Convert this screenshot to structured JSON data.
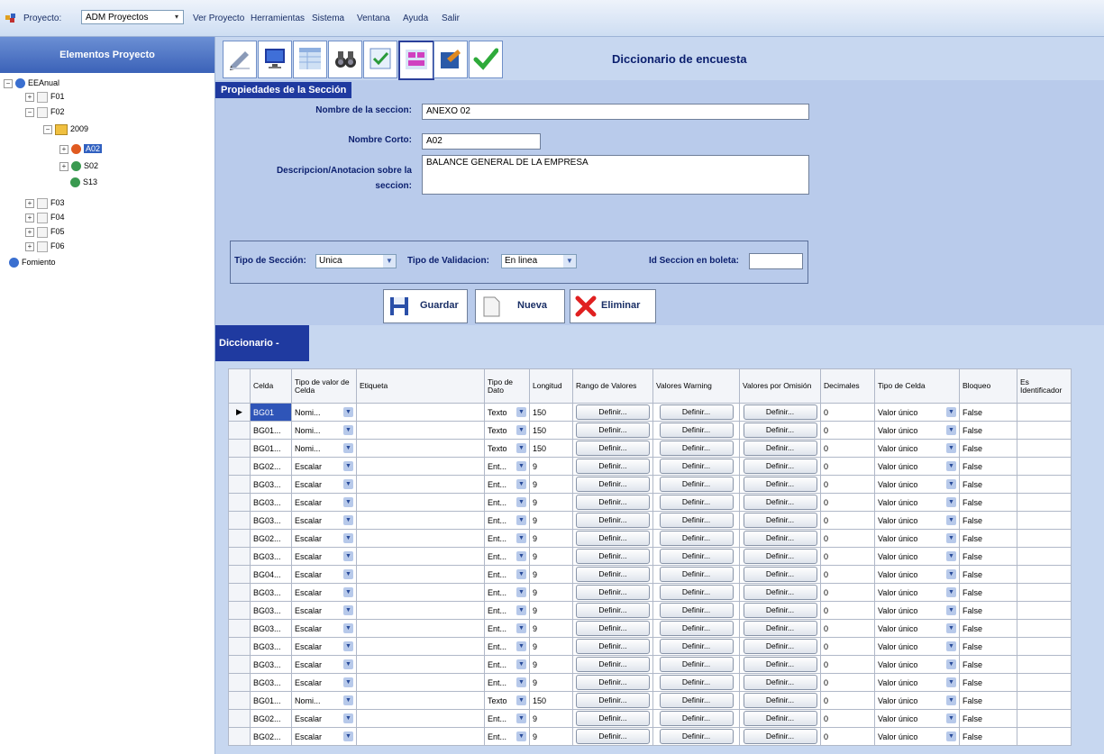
{
  "menubar": {
    "project_label": "Proyecto:",
    "project_value": "ADM Proyectos",
    "items": [
      "Ver Proyecto",
      "Herramientas",
      "Sistema",
      "Ventana",
      "Ayuda",
      "Salir"
    ]
  },
  "sidebar": {
    "title": "Elementos Proyecto",
    "tree": {
      "root": "EEAnual",
      "f01": "F01",
      "f02": "F02",
      "year": "2009",
      "a02": "A02",
      "s02": "S02",
      "s13": "S13",
      "f03": "F03",
      "f04": "F04",
      "f05": "F05",
      "f06": "F06",
      "fomiento": "Fomiento"
    }
  },
  "toolbar": {
    "title": "Diccionario de encuesta",
    "icons": [
      "pen-icon",
      "monitor-icon",
      "grid-icon",
      "binoculars-icon",
      "checklist-icon",
      "layout-icon",
      "export-icon",
      "checkmark-icon"
    ]
  },
  "section": {
    "title": "Propiedades de la Sección",
    "name_label": "Nombre de la seccion:",
    "name_value": "ANEXO 02",
    "short_label": "Nombre Corto:",
    "short_value": "A02",
    "desc_label_1": "Descripcion/Anotacion sobre la",
    "desc_label_2": "seccion:",
    "desc_value": "BALANCE GENERAL DE LA EMPRESA",
    "type_label": "Tipo de Sección:",
    "type_value": "Unica",
    "validation_label": "Tipo de Validacion:",
    "validation_value": "En linea",
    "ballot_label": "Id Seccion en boleta:",
    "ballot_value": ""
  },
  "actions": {
    "save": "Guardar",
    "new": "Nueva",
    "delete": "Eliminar"
  },
  "dictionary": {
    "tab_label": "Diccionario -",
    "columns": [
      "Celda",
      "Tipo de valor de Celda",
      "Etiqueta",
      "Tipo de Dato",
      "Longitud",
      "Rango de Valores",
      "Valores Warning",
      "Valores por Omisión",
      "Decimales",
      "Tipo de Celda",
      "Bloqueo",
      "Es Identificador"
    ],
    "button_label": "Definir...",
    "rows": [
      {
        "celda": "BG01",
        "tipo_valor": "Nomi...",
        "tipo_dato": "Texto",
        "longitud": "150",
        "decimales": "0",
        "tipo_celda": "Valor único",
        "bloqueo": "False"
      },
      {
        "celda": "BG01...",
        "tipo_valor": "Nomi...",
        "tipo_dato": "Texto",
        "longitud": "150",
        "decimales": "0",
        "tipo_celda": "Valor único",
        "bloqueo": "False"
      },
      {
        "celda": "BG01...",
        "tipo_valor": "Nomi...",
        "tipo_dato": "Texto",
        "longitud": "150",
        "decimales": "0",
        "tipo_celda": "Valor único",
        "bloqueo": "False"
      },
      {
        "celda": "BG02...",
        "tipo_valor": "Escalar",
        "tipo_dato": "Ent...",
        "longitud": "9",
        "decimales": "0",
        "tipo_celda": "Valor único",
        "bloqueo": "False"
      },
      {
        "celda": "BG03...",
        "tipo_valor": "Escalar",
        "tipo_dato": "Ent...",
        "longitud": "9",
        "decimales": "0",
        "tipo_celda": "Valor único",
        "bloqueo": "False"
      },
      {
        "celda": "BG03...",
        "tipo_valor": "Escalar",
        "tipo_dato": "Ent...",
        "longitud": "9",
        "decimales": "0",
        "tipo_celda": "Valor único",
        "bloqueo": "False"
      },
      {
        "celda": "BG03...",
        "tipo_valor": "Escalar",
        "tipo_dato": "Ent...",
        "longitud": "9",
        "decimales": "0",
        "tipo_celda": "Valor único",
        "bloqueo": "False"
      },
      {
        "celda": "BG02...",
        "tipo_valor": "Escalar",
        "tipo_dato": "Ent...",
        "longitud": "9",
        "decimales": "0",
        "tipo_celda": "Valor único",
        "bloqueo": "False"
      },
      {
        "celda": "BG03...",
        "tipo_valor": "Escalar",
        "tipo_dato": "Ent...",
        "longitud": "9",
        "decimales": "0",
        "tipo_celda": "Valor único",
        "bloqueo": "False"
      },
      {
        "celda": "BG04...",
        "tipo_valor": "Escalar",
        "tipo_dato": "Ent...",
        "longitud": "9",
        "decimales": "0",
        "tipo_celda": "Valor único",
        "bloqueo": "False"
      },
      {
        "celda": "BG03...",
        "tipo_valor": "Escalar",
        "tipo_dato": "Ent...",
        "longitud": "9",
        "decimales": "0",
        "tipo_celda": "Valor único",
        "bloqueo": "False"
      },
      {
        "celda": "BG03...",
        "tipo_valor": "Escalar",
        "tipo_dato": "Ent...",
        "longitud": "9",
        "decimales": "0",
        "tipo_celda": "Valor único",
        "bloqueo": "False"
      },
      {
        "celda": "BG03...",
        "tipo_valor": "Escalar",
        "tipo_dato": "Ent...",
        "longitud": "9",
        "decimales": "0",
        "tipo_celda": "Valor único",
        "bloqueo": "False"
      },
      {
        "celda": "BG03...",
        "tipo_valor": "Escalar",
        "tipo_dato": "Ent...",
        "longitud": "9",
        "decimales": "0",
        "tipo_celda": "Valor único",
        "bloqueo": "False"
      },
      {
        "celda": "BG03...",
        "tipo_valor": "Escalar",
        "tipo_dato": "Ent...",
        "longitud": "9",
        "decimales": "0",
        "tipo_celda": "Valor único",
        "bloqueo": "False"
      },
      {
        "celda": "BG03...",
        "tipo_valor": "Escalar",
        "tipo_dato": "Ent...",
        "longitud": "9",
        "decimales": "0",
        "tipo_celda": "Valor único",
        "bloqueo": "False"
      },
      {
        "celda": "BG01...",
        "tipo_valor": "Nomi...",
        "tipo_dato": "Texto",
        "longitud": "150",
        "decimales": "0",
        "tipo_celda": "Valor único",
        "bloqueo": "False"
      },
      {
        "celda": "BG02...",
        "tipo_valor": "Escalar",
        "tipo_dato": "Ent...",
        "longitud": "9",
        "decimales": "0",
        "tipo_celda": "Valor único",
        "bloqueo": "False"
      },
      {
        "celda": "BG02...",
        "tipo_valor": "Escalar",
        "tipo_dato": "Ent...",
        "longitud": "9",
        "decimales": "0",
        "tipo_celda": "Valor único",
        "bloqueo": "False"
      }
    ]
  },
  "colors": {
    "header_blue": "#1f3aa0",
    "panel_blue": "#b9cbeb",
    "accent_text": "#0b1f6e"
  }
}
